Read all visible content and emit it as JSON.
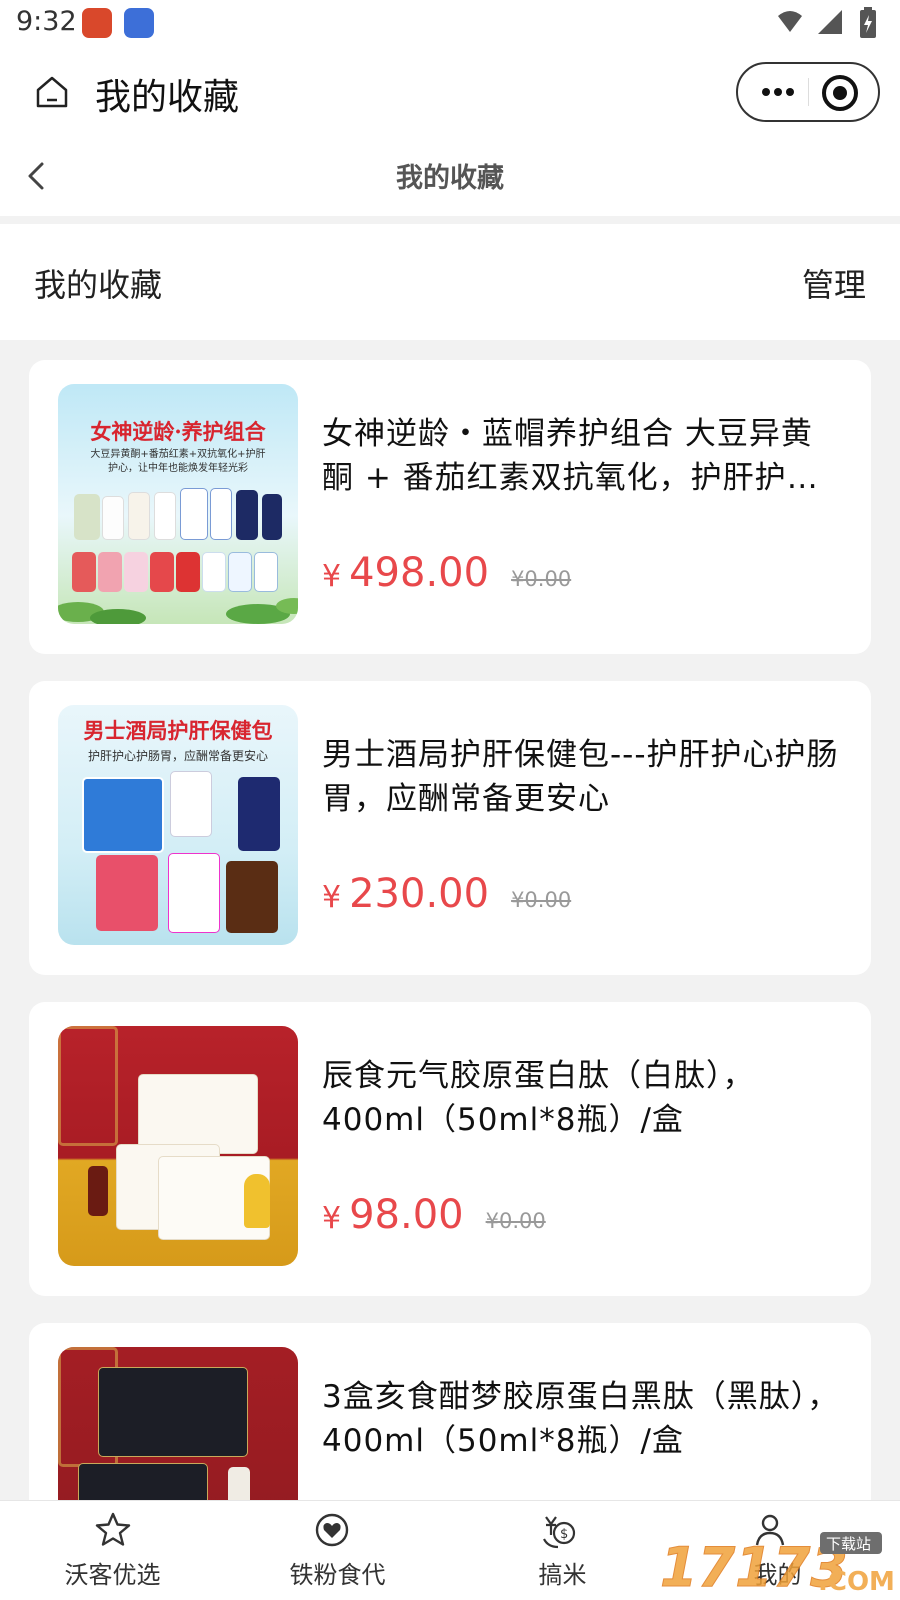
{
  "status": {
    "time": "9:32"
  },
  "header": {
    "title": "我的收藏"
  },
  "nav": {
    "title": "我的收藏"
  },
  "section": {
    "title": "我的收藏",
    "manage_label": "管理"
  },
  "products": [
    {
      "name": "女神逆龄・蓝帽养护组合 大豆异黄酮 + 番茄红素双抗氧化，护肝护心，让中年也能焕发年轻光彩",
      "price_symbol": "¥",
      "price": "498.00",
      "original_price": "¥0.00",
      "image_title": "女神逆龄·养护组合",
      "image_sub": "大豆异黄酮+番茄红素+双抗氧化+护肝护心，让中年也能焕发年轻光彩"
    },
    {
      "name": "男士酒局护肝保健包---护肝护心护肠胃，应酬常备更安心",
      "price_symbol": "¥",
      "price": "230.00",
      "original_price": "¥0.00",
      "image_title": "男士酒局护肝保健包",
      "image_sub": "护肝护心护肠胃，应酬常备更安心"
    },
    {
      "name": "辰食元气胶原蛋白肽（白肽），400ml（50ml*8瓶）/盒",
      "price_symbol": "¥",
      "price": "98.00",
      "original_price": "¥0.00"
    },
    {
      "name": "3盒亥食酣梦胶原蛋白黑肽（黑肽），400ml（50ml*8瓶）/盒",
      "price_symbol": "¥",
      "price": "",
      "original_price": ""
    }
  ],
  "tabs": [
    {
      "label": "沃客优选",
      "icon": "star-icon"
    },
    {
      "label": "铁粉食代",
      "icon": "heart-icon"
    },
    {
      "label": "搞米",
      "icon": "money-exchange-icon"
    },
    {
      "label": "我的",
      "icon": "user-icon"
    }
  ],
  "colors": {
    "price": "#e8484b",
    "background": "#f2f2f2"
  }
}
